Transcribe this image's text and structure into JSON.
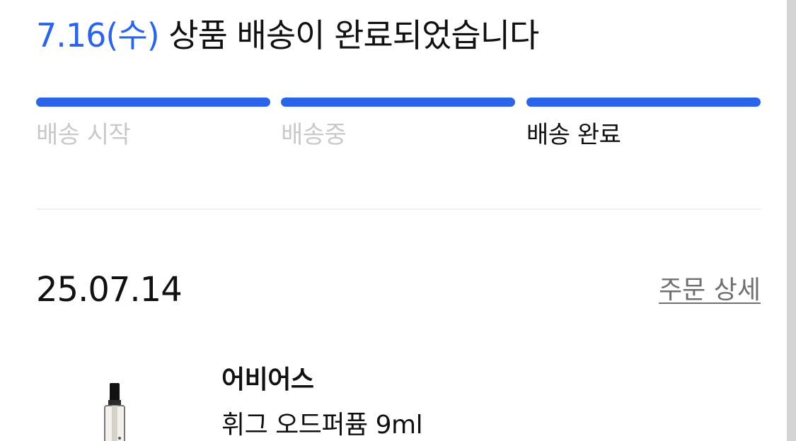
{
  "delivery": {
    "date_label": "7.16(수)",
    "status_title": "상품 배송이 완료되었습니다",
    "accent_color": "#2a64ea",
    "progress_fraction": 1.0,
    "steps": [
      {
        "label": "배송 시작",
        "active": false
      },
      {
        "label": "배송중",
        "active": false
      },
      {
        "label": "배송 완료",
        "active": true
      }
    ]
  },
  "order": {
    "date": "25.07.14",
    "detail_link": "주문 상세"
  },
  "product": {
    "brand": "어비어스",
    "name": "휘그 오드퍼퓸 9ml",
    "image_icon": "perfume-bottle-icon"
  }
}
